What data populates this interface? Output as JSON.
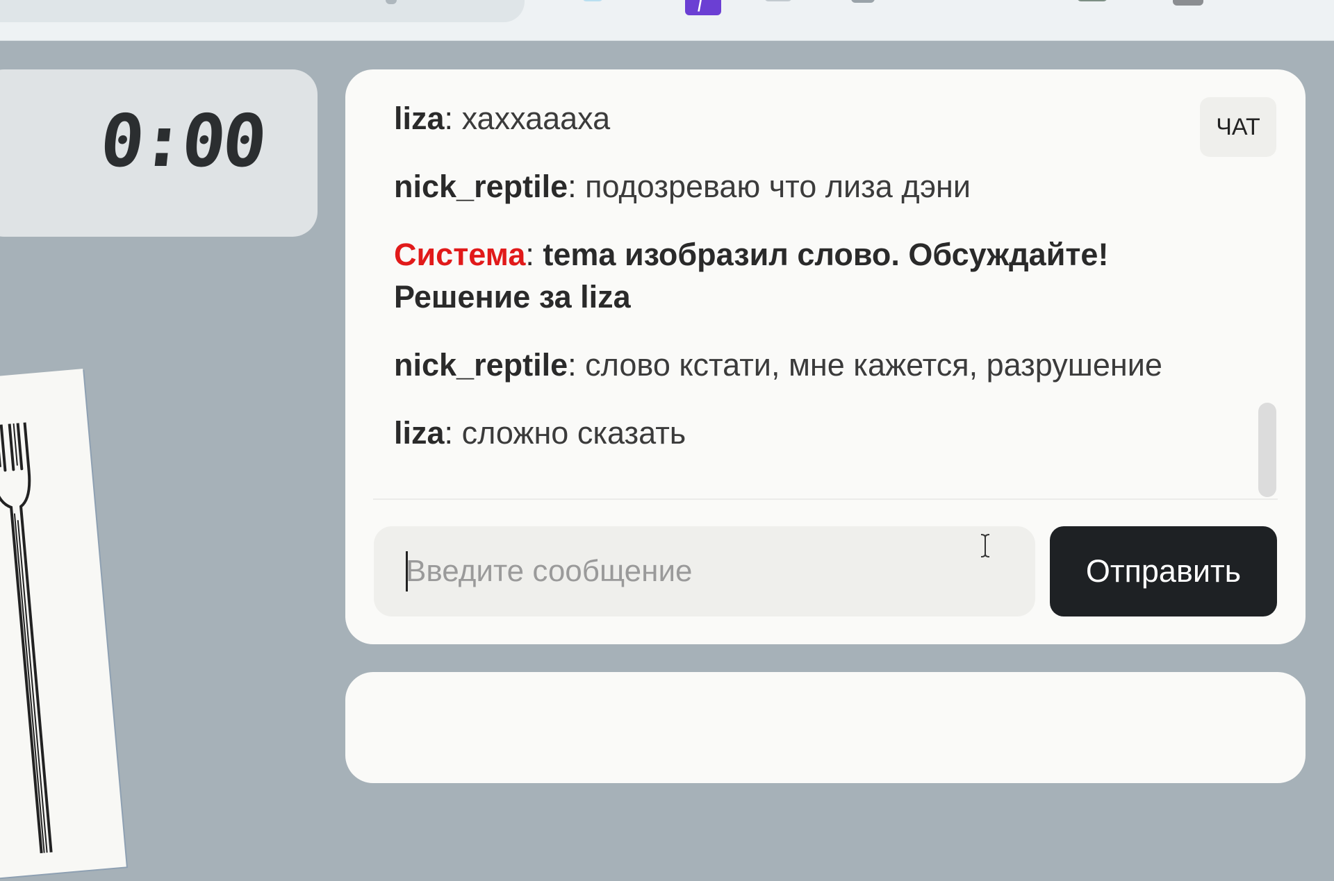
{
  "timer": {
    "value": "0:00"
  },
  "chat": {
    "tag_label": "ЧАТ",
    "messages": [
      {
        "author": "liza",
        "sep": ": ",
        "text": "хаххаааха"
      },
      {
        "author": "nick_reptile",
        "sep": ": ",
        "text": "подозреваю что лиза дэни"
      },
      {
        "author": "Система",
        "sep": ": ",
        "text": "tema изобразил слово. Обсуждайте! Решение за liza"
      },
      {
        "author": "nick_reptile",
        "sep": ": ",
        "text": "слово кстати, мне кажется, разрушение"
      },
      {
        "author": "liza",
        "sep": ": ",
        "text": "сложно сказать"
      }
    ],
    "input": {
      "placeholder": "Введите сообщение",
      "value": ""
    },
    "send_label": "Отправить"
  },
  "colors": {
    "background": "#a6b1b8",
    "system_author": "#e11a1a",
    "send_button": "#1e2124",
    "extension_accent": "#6b3fd3"
  },
  "icons": {
    "extension_purple": "yahoo-extension-icon",
    "drawing": "fork-drawing"
  }
}
